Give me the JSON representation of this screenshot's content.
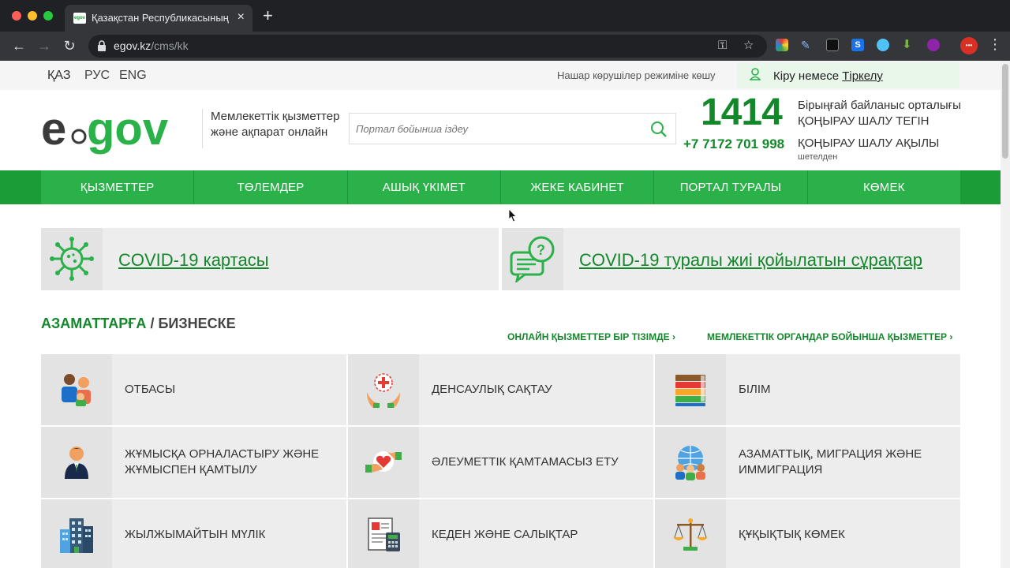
{
  "browser": {
    "tab_title": "Қазақстан Республикасының",
    "url_host": "egov.kz",
    "url_path": "/cms/kk",
    "favicon_text": "egov"
  },
  "top": {
    "languages": [
      "ҚАЗ",
      "РУС",
      "ENG"
    ],
    "vision_mode": "Нашар көрушілер режиміне көшу",
    "login": "Кіру",
    "or": "немесе",
    "register": "Тіркелу"
  },
  "header": {
    "tagline_line1": "Мемлекеттік қызметтер",
    "tagline_line2": "және ақпарат онлайн",
    "search_placeholder": "Портал бойынша іздеу",
    "phone_short": "1414",
    "phone_short_note1": "Бірыңғай байланыс орталығы",
    "phone_short_note2": "ҚОҢЫРАУ ШАЛУ ТЕГІН",
    "phone_long": "+7 7172 701 998",
    "phone_long_note": "ҚОҢЫРАУ ШАЛУ АҚЫЛЫ",
    "phone_long_sub": "шетелден"
  },
  "nav": [
    "ҚЫЗМЕТТЕР",
    "ТӨЛЕМДЕР",
    "АШЫҚ ҮКІМЕТ",
    "ЖЕКЕ КАБИНЕТ",
    "ПОРТАЛ ТУРАЛЫ",
    "КӨМЕК"
  ],
  "covid": {
    "map_link": "COVID-19 картасы",
    "faq_link": "COVID-19 туралы жиі қойылатын сұрақтар"
  },
  "section": {
    "title_active": "АЗАМАТТАРҒА",
    "separator": "/",
    "title_other": "БИЗНЕСКЕ",
    "link_online": "ОНЛАЙН ҚЫЗМЕТТЕР БІР ТІЗІМДЕ ›",
    "link_agencies": "МЕМЛЕКЕТТІК ОРГАНДАР БОЙЫНША ҚЫЗМЕТТЕР ›"
  },
  "categories": [
    {
      "label": "ОТБАСЫ",
      "icon": "family-icon"
    },
    {
      "label": "ДЕНСАУЛЫҚ САҚТАУ",
      "icon": "healthcare-icon"
    },
    {
      "label": "БІЛІМ",
      "icon": "books-icon"
    },
    {
      "label": "ЖҰМЫСҚА ОРНАЛАСТЫРУ ЖӘНЕ ЖҰМЫСПЕН ҚАМТЫЛУ",
      "icon": "employee-icon"
    },
    {
      "label": "ӘЛЕУМЕТТІК ҚАМТАМАСЫЗ ЕТУ",
      "icon": "social-care-icon"
    },
    {
      "label": "АЗАМАТТЫҚ, МИГРАЦИЯ ЖӘНЕ ИММИГРАЦИЯ",
      "icon": "globe-people-icon"
    },
    {
      "label": "ЖЫЛЖЫМАЙТЫН МҮЛІК",
      "icon": "buildings-icon"
    },
    {
      "label": "КЕДЕН ЖӘНЕ САЛЫҚТАР",
      "icon": "tax-document-icon"
    },
    {
      "label": "ҚҰҚЫҚТЫҚ КӨМЕК",
      "icon": "scales-icon"
    }
  ]
}
